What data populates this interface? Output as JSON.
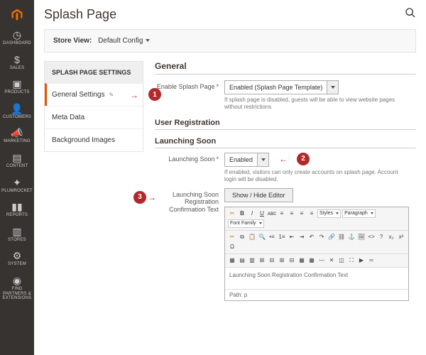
{
  "sidebar": {
    "items": [
      {
        "label": "DASHBOARD",
        "icon": "dashboard-icon",
        "glyph": "◷"
      },
      {
        "label": "SALES",
        "icon": "sales-icon",
        "glyph": "$"
      },
      {
        "label": "PRODUCTS",
        "icon": "products-icon",
        "glyph": "▣"
      },
      {
        "label": "CUSTOMERS",
        "icon": "customers-icon",
        "glyph": "👤"
      },
      {
        "label": "MARKETING",
        "icon": "marketing-icon",
        "glyph": "📣"
      },
      {
        "label": "CONTENT",
        "icon": "content-icon",
        "glyph": "▤"
      },
      {
        "label": "PLUMROCKET",
        "icon": "plumrocket-icon",
        "glyph": "✦"
      },
      {
        "label": "REPORTS",
        "icon": "reports-icon",
        "glyph": "▮▮"
      },
      {
        "label": "STORES",
        "icon": "stores-icon",
        "glyph": "▥"
      },
      {
        "label": "SYSTEM",
        "icon": "system-icon",
        "glyph": "⚙"
      },
      {
        "label": "FIND PARTNERS & EXTENSIONS",
        "icon": "partners-icon",
        "glyph": "◉"
      }
    ]
  },
  "header": {
    "title": "Splash Page"
  },
  "storeview": {
    "label": "Store View:",
    "value": "Default Config"
  },
  "settings_nav": {
    "title": "SPLASH PAGE SETTINGS",
    "items": [
      {
        "label": "General Settings",
        "active": true
      },
      {
        "label": "Meta Data",
        "active": false
      },
      {
        "label": "Background Images",
        "active": false
      }
    ]
  },
  "sections": {
    "general": {
      "title": "General",
      "enable": {
        "label": "Enable Splash Page",
        "value": "Enabled (Splash Page Template)",
        "help": "If splash page is disabled, guests will be able to view website pages without restrictions"
      }
    },
    "user_reg": {
      "title": "User Registration"
    },
    "launching": {
      "title": "Launching Soon",
      "enable": {
        "label": "Launching Soon",
        "value": "Enabled",
        "help": "If enabled, visitors can only create accounts on splash page. Account login will be disabled."
      },
      "editor": {
        "label": "Launching Soon Registration Confirmation Text",
        "button": "Show / Hide Editor",
        "content": "Launching Soon Registration Confirmation Text",
        "path_label": "Path:",
        "path_value": "p",
        "toolbar_styles": "Styles",
        "toolbar_paragraph": "Paragraph",
        "toolbar_fontfamily": "Font Family"
      }
    }
  },
  "callouts": {
    "c1": "1",
    "c2": "2",
    "c3": "3"
  }
}
